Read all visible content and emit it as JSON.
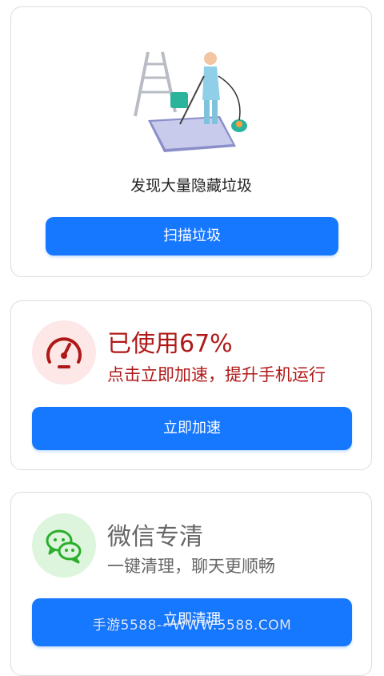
{
  "clean_card": {
    "title": "发现大量隐藏垃圾",
    "button_label": "扫描垃圾"
  },
  "speed_card": {
    "usage_text": "已使用67%",
    "tip_text": "点击立即加速，提升手机运行",
    "button_label": "立即加速",
    "icon": "speedometer-icon",
    "accent_color": "#b01818"
  },
  "wechat_card": {
    "title": "微信专清",
    "tip_text": "一键清理，聊天更顺畅",
    "button_label": "立即清理",
    "icon": "wechat-icon",
    "accent_color": "#2aae2a"
  },
  "watermark": "手游5588---WWW.5588.COM",
  "colors": {
    "primary_button": "#1677ff"
  }
}
